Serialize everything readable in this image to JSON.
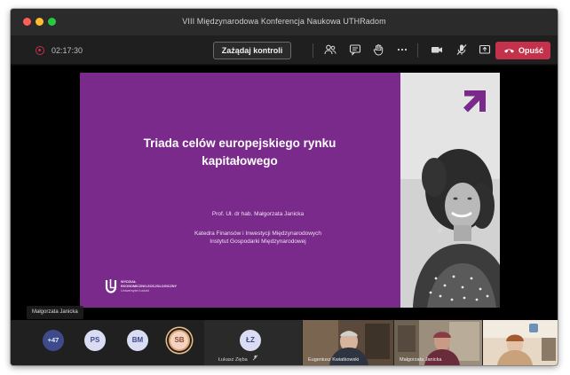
{
  "window": {
    "title": "VIII Międzynarodowa Konferencja Naukowa UTHRadom"
  },
  "toolbar": {
    "timer": "02:17:30",
    "control_label": "Zażądaj kontroli",
    "leave_label": "Opuść",
    "icons": [
      "participants-icon",
      "chat-icon",
      "raise-hand-icon",
      "more-icon",
      "camera-icon",
      "mic-muted-icon",
      "share-icon",
      "phone-icon"
    ]
  },
  "slide": {
    "title": "Triada celów europejskiego rynku kapitałowego",
    "author": "Prof. Uł. dr hab. Małgorzata Janicka",
    "dept_line1": "Katedra Finansów i Inwestycji Międzynarodowych",
    "dept_line2": "Instytut Gospodarki Międzynarodowej",
    "logo_line1": "WYDZIAŁ",
    "logo_line2": "EKONOMICZNO-SOCJOLOGICZNY",
    "logo_line3": "Uniwersytet Łódzki",
    "accent": "#7a2a8a"
  },
  "presenter": {
    "name": "Małgorzata Janicka"
  },
  "participants": {
    "more": "+47",
    "avatars": [
      "PS",
      "BM",
      "SB"
    ],
    "tile_initials": "ŁZ",
    "tile_name": "Łukasz Zięba",
    "video1_name": "Eugeniusz Kwiatkowski",
    "video2_name": "Małgorzata Janicka"
  },
  "colors": {
    "leave": "#c4314b",
    "avatar_bg": "#d9dcf2",
    "avatar_text": "#3f4a8a"
  }
}
